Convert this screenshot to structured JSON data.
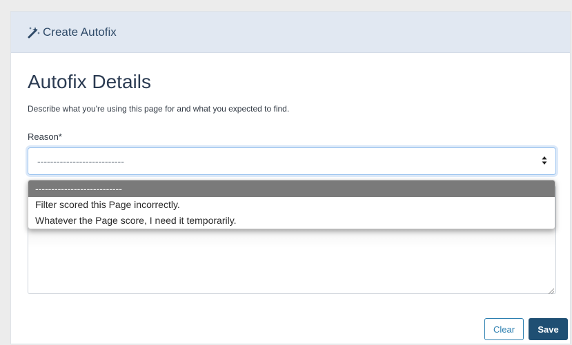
{
  "header": {
    "icon": "magic-wand-icon",
    "title": "Create Autofix"
  },
  "form": {
    "title": "Autofix Details",
    "subtitle": "Describe what you're using this page for and what you expected to find.",
    "reason_label": "Reason*",
    "reason_value": "---------------------------",
    "reason_options": [
      "---------------------------",
      "Filter scored this Page incorrectly.",
      "Whatever the Page score, I need it temporarily."
    ]
  },
  "buttons": {
    "clear": "Clear",
    "save": "Save"
  },
  "colors": {
    "header_bg": "#e1e8f2",
    "accent": "#2c7fb0",
    "primary": "#1f4f73",
    "selected_option_bg": "#7a7a7a"
  }
}
